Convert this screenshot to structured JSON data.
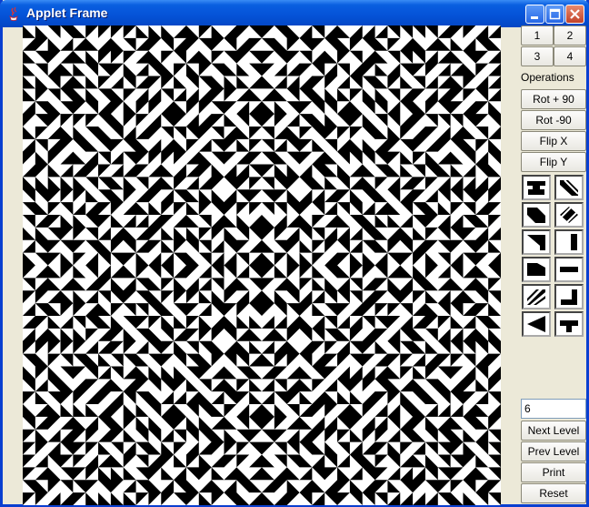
{
  "window": {
    "title": "Applet Frame"
  },
  "titlebar": {
    "icons": [
      "java-icon",
      "minimize-icon",
      "maximize-icon",
      "close-icon"
    ]
  },
  "tile_set_buttons": [
    "1",
    "2",
    "3",
    "4"
  ],
  "operations": {
    "label": "Operations",
    "buttons": [
      "Rot + 90",
      "Rot -90",
      "Flip X",
      "Flip Y"
    ]
  },
  "tiles": [
    "tile-t-shape",
    "tile-diagonal-stripe",
    "tile-chamfer",
    "tile-rotate-pinwheel",
    "tile-triangle-corner",
    "tile-vertical-bar",
    "tile-trapezoid",
    "tile-horizontal-bar",
    "tile-double-diagonal",
    "tile-l-corner",
    "tile-left-triangle",
    "tile-t-inverted"
  ],
  "level": {
    "value": "6"
  },
  "level_buttons": [
    "Next Level",
    "Prev Level",
    "Print",
    "Reset"
  ],
  "colors": {
    "title_bar": "#0553d8",
    "panel": "#ece9d8",
    "pattern_fg": "#000000",
    "pattern_bg": "#ffffff"
  }
}
